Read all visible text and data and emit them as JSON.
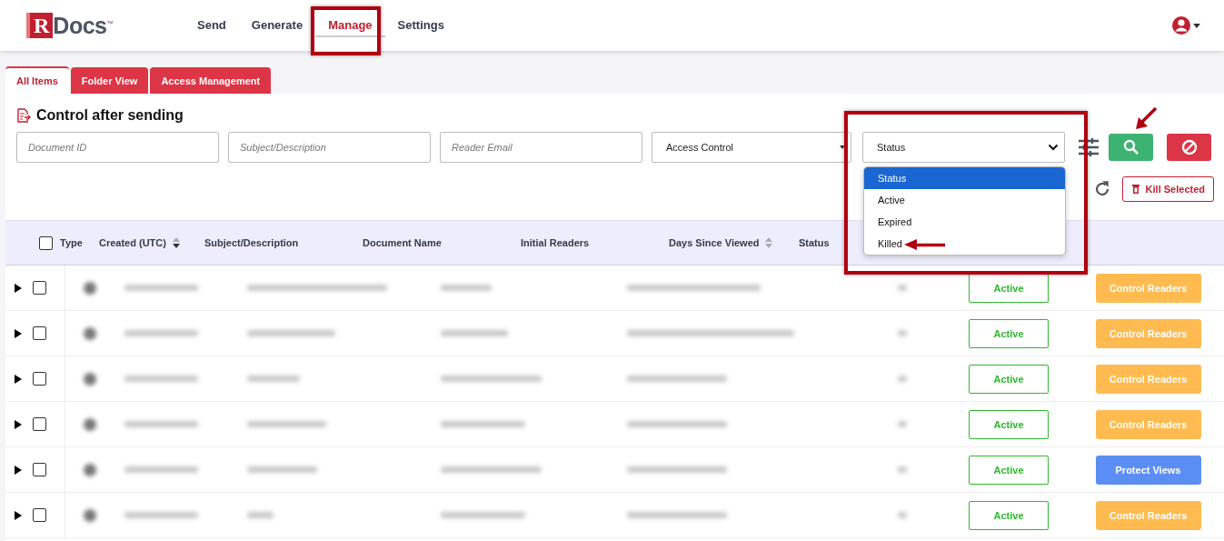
{
  "nav": {
    "logo_letter": "R",
    "logo_text": "Docs",
    "logo_mark": "™",
    "items": [
      {
        "label": "Send",
        "selected": false
      },
      {
        "label": "Generate",
        "selected": false
      },
      {
        "label": "Manage",
        "selected": true
      },
      {
        "label": "Settings",
        "selected": false
      }
    ]
  },
  "tabs": [
    {
      "label": "All Items",
      "selected": true
    },
    {
      "label": "Folder View",
      "selected": false
    },
    {
      "label": "Access Management",
      "selected": false
    }
  ],
  "title": "Control after sending",
  "filters": {
    "fields": [
      {
        "placeholder": "Document ID"
      },
      {
        "placeholder": "Subject/Description"
      },
      {
        "placeholder": "Reader Email"
      }
    ],
    "access_control": "Access Control",
    "status": "Status",
    "status_options": [
      {
        "label": "Status",
        "selected": true
      },
      {
        "label": "Active",
        "selected": false
      },
      {
        "label": "Expired",
        "selected": false
      },
      {
        "label": "Killed",
        "selected": false
      }
    ]
  },
  "kill_button": "Kill Selected",
  "table": {
    "all_checked": false,
    "columns": [
      "Type",
      "Created (UTC)",
      "Subject/Description",
      "Document Name",
      "Initial Readers",
      "Days Since Viewed",
      "Status"
    ],
    "rows": [
      {
        "checked": false,
        "status": "Active",
        "action": "Control Readers",
        "kind": "control"
      },
      {
        "checked": false,
        "status": "Active",
        "action": "Control Readers",
        "kind": "control"
      },
      {
        "checked": false,
        "status": "Active",
        "action": "Control Readers",
        "kind": "control"
      },
      {
        "checked": false,
        "status": "Active",
        "action": "Control Readers",
        "kind": "control"
      },
      {
        "checked": false,
        "status": "Active",
        "action": "Protect Views",
        "kind": "protect"
      },
      {
        "checked": false,
        "status": "Active",
        "action": "Control Readers",
        "kind": "control"
      }
    ]
  }
}
